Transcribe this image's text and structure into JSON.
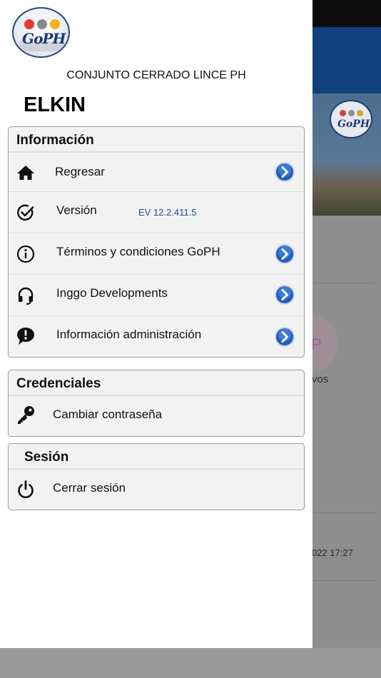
{
  "background_app": {
    "partial_label": "vos",
    "partial_date": "022 17:27",
    "logo_text": "GoPH"
  },
  "drawer": {
    "logo_text": "GoPH",
    "logo_dot_colors": [
      "#e33a32",
      "#8b8b8b",
      "#f2b21c"
    ],
    "organization": "CONJUNTO CERRADO LINCE PH",
    "user_name": "ELKIN"
  },
  "sections": {
    "info": {
      "title": "Información",
      "items": [
        {
          "label": "Regresar",
          "icon": "home-icon"
        },
        {
          "label": "Versión",
          "icon": "check-circle-icon",
          "value": "EV  12.2.411.5"
        },
        {
          "label": "Términos y condiciones GoPH",
          "icon": "info-icon"
        },
        {
          "label": "Inggo Developments",
          "icon": "headset-icon"
        },
        {
          "label": "Información administración",
          "icon": "alert-bubble-icon"
        }
      ]
    },
    "credentials": {
      "title": "Credenciales",
      "items": [
        {
          "label": "Cambiar contraseña",
          "icon": "key-icon"
        }
      ]
    },
    "session": {
      "title": "Sesión",
      "items": [
        {
          "label": "Cerrar sesión",
          "icon": "power-icon"
        }
      ]
    }
  },
  "colors": {
    "accent_blue": "#1d5fc4",
    "header_blue": "#11407f"
  }
}
